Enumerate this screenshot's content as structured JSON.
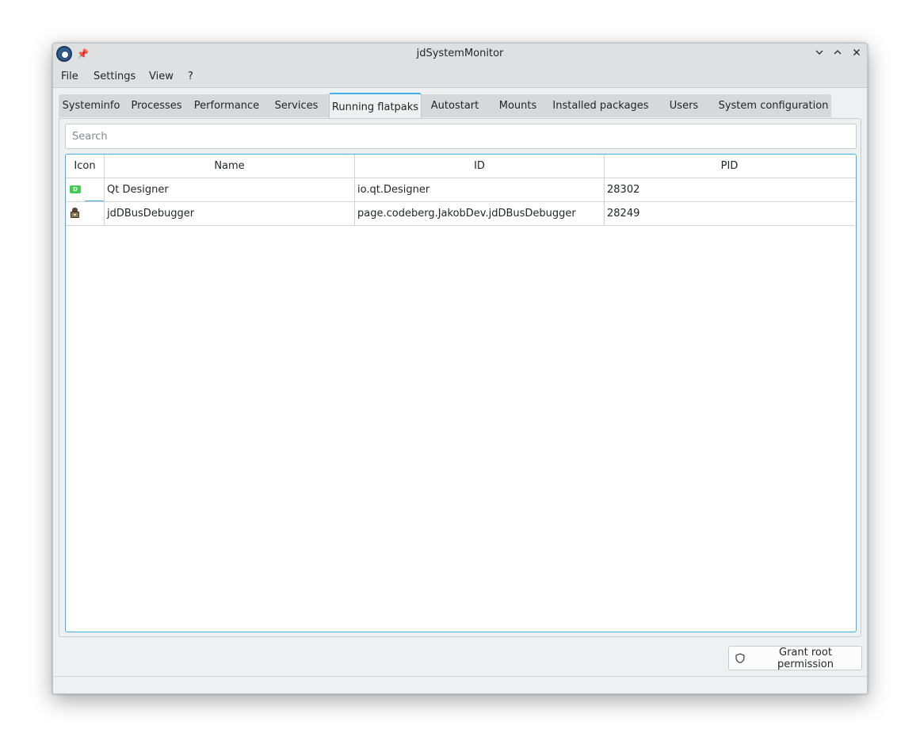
{
  "window": {
    "title": "jdSystemMonitor"
  },
  "menubar": {
    "items": [
      "File",
      "Settings",
      "View",
      "?"
    ]
  },
  "tabs": {
    "items": [
      "Systeminfo",
      "Processes",
      "Performance",
      "Services",
      "Running flatpaks",
      "Autostart",
      "Mounts",
      "Installed packages",
      "Users",
      "System configuration"
    ],
    "active": "Running flatpaks"
  },
  "search": {
    "placeholder": "Search"
  },
  "table": {
    "headers": [
      "Icon",
      "Name",
      "ID",
      "PID"
    ],
    "rows": [
      {
        "icon": "qt-designer-icon",
        "icon_label": "D",
        "name": "Qt Designer",
        "id": "io.qt.Designer",
        "pid": "28302"
      },
      {
        "icon": "dbus-debugger-icon",
        "name": "jdDBusDebugger",
        "id": "page.codeberg.JakobDev.jdDBusDebugger",
        "pid": "28249"
      }
    ]
  },
  "footer": {
    "grant_root_label": "Grant root permission"
  },
  "colors": {
    "accent": "#3daee9",
    "window_bg": "#eff0f1",
    "titlebar_bg": "#dee0e2",
    "qt_green": "#41cd52"
  }
}
